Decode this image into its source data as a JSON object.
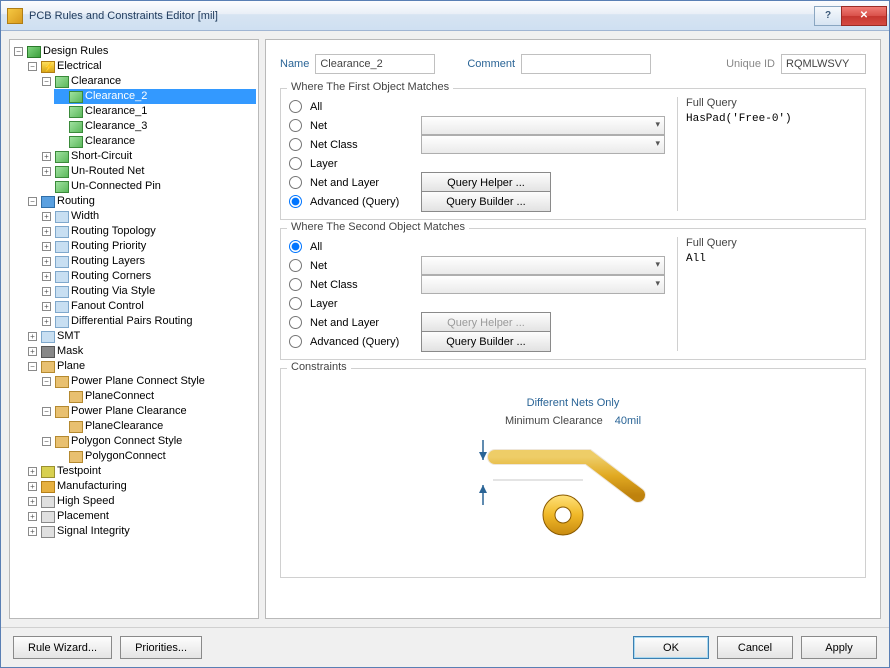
{
  "window": {
    "title": "PCB Rules and Constraints Editor [mil]"
  },
  "tree": {
    "root": "Design Rules",
    "electrical": "Electrical",
    "clearance": "Clearance",
    "clearance_items": [
      "Clearance_2",
      "Clearance_1",
      "Clearance_3",
      "Clearance"
    ],
    "short": "Short-Circuit",
    "unrouted": "Un-Routed Net",
    "unconn": "Un-Connected Pin",
    "routing": "Routing",
    "routing_items": [
      "Width",
      "Routing Topology",
      "Routing Priority",
      "Routing Layers",
      "Routing Corners",
      "Routing Via Style",
      "Fanout Control",
      "Differential Pairs Routing"
    ],
    "smt": "SMT",
    "mask": "Mask",
    "plane": "Plane",
    "ppcs": "Power Plane Connect Style",
    "ppcs_c": "PlaneConnect",
    "ppc": "Power Plane Clearance",
    "ppc_c": "PlaneClearance",
    "pcs": "Polygon Connect Style",
    "pcs_c": "PolygonConnect",
    "tp": "Testpoint",
    "mfg": "Manufacturing",
    "hs": "High Speed",
    "placement": "Placement",
    "si": "Signal Integrity"
  },
  "header": {
    "name_label": "Name",
    "name_value": "Clearance_2",
    "comment_label": "Comment",
    "comment_value": "",
    "uid_label": "Unique ID",
    "uid_value": "RQMLWSVY"
  },
  "match1": {
    "title": "Where The First Object Matches",
    "options": [
      "All",
      "Net",
      "Net Class",
      "Layer",
      "Net and Layer",
      "Advanced (Query)"
    ],
    "selected": 5,
    "query_helper": "Query Helper ...",
    "query_builder": "Query Builder ...",
    "fq_label": "Full Query",
    "fq_value": "HasPad('Free-0')"
  },
  "match2": {
    "title": "Where The Second Object Matches",
    "options": [
      "All",
      "Net",
      "Net Class",
      "Layer",
      "Net and Layer",
      "Advanced (Query)"
    ],
    "selected": 0,
    "query_helper": "Query Helper ...",
    "query_builder": "Query Builder ...",
    "fq_label": "Full Query",
    "fq_value": "All"
  },
  "constraints": {
    "title": "Constraints",
    "dno": "Different Nets Only",
    "min_label": "Minimum Clearance",
    "min_value": "40mil"
  },
  "footer": {
    "wizard": "Rule Wizard...",
    "priorities": "Priorities...",
    "ok": "OK",
    "cancel": "Cancel",
    "apply": "Apply"
  }
}
